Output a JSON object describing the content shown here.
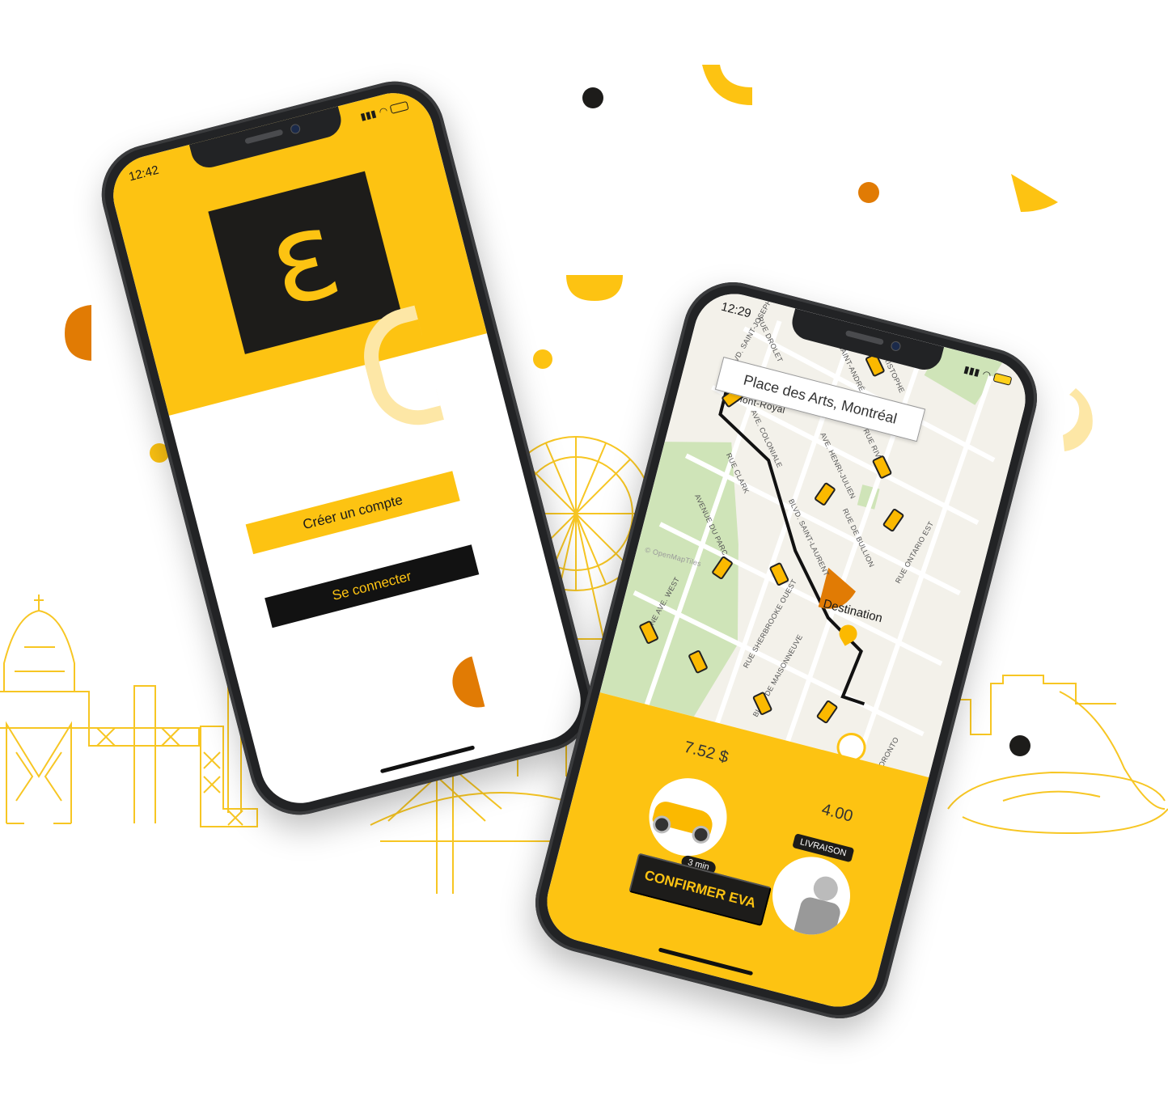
{
  "theme": {
    "yellow": "#fdc312",
    "dark": "#1d1c1a",
    "orange": "#e17b04",
    "map_bg": "#f3f1ea",
    "park": "#cfe4b8"
  },
  "login_phone": {
    "status_time": "12:42",
    "logo_glyph": "ε",
    "create_account_label": "Créer un compte",
    "login_label": "Se connecter"
  },
  "ride_phone": {
    "status_time": "12:29",
    "search_value": "Place des Arts, Montréal",
    "destination_label": "Destination",
    "map_attribution": "© OpenMapTiles",
    "streets": [
      "BLVD. SAINT-JOSEPH",
      "RUE DROLET",
      "RUE SAINT-ANDRÉ",
      "RUE CHRISTOPHE",
      "Mont-Royal",
      "AVE. COLONIALE",
      "AVE. HENRI-JULIEN",
      "RUE RIVARD",
      "RUE CLARK",
      "BLVD. SAINT-LAURENT",
      "RUE DE BULLION",
      "RUE ONTARIO EST",
      "AVENUE DU PARC",
      "PINE AVE. WEST",
      "RUE SHERBROOKE OUEST",
      "BLVD. DE MAISONNEUVE",
      "TORONTO"
    ],
    "price_primary": "7.52 $",
    "price_secondary": "4.00",
    "eta_label": "3 min",
    "delivery_label": "LIVRAISON",
    "confirm_label": "CONFIRMER EVA"
  }
}
